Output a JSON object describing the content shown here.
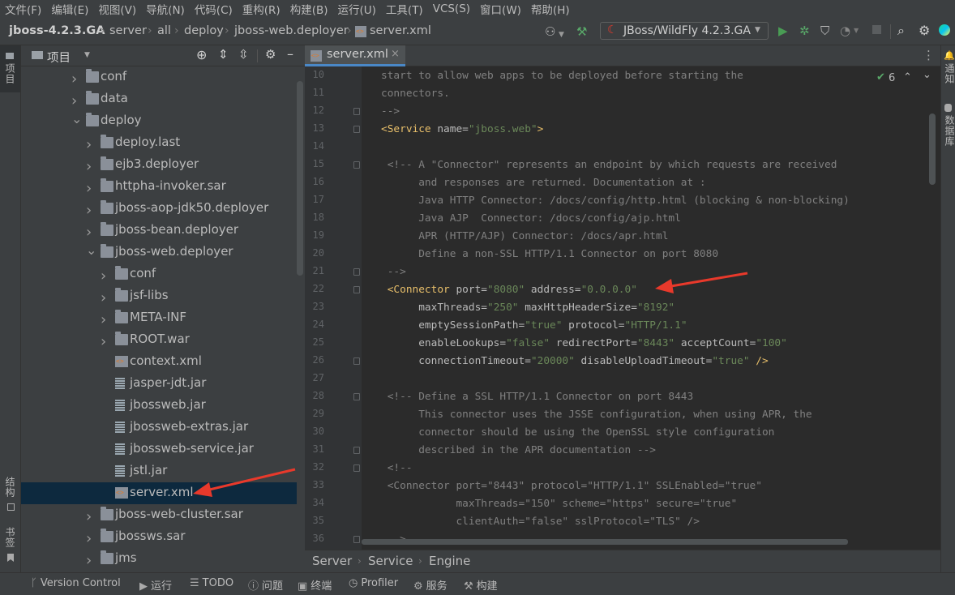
{
  "menu": [
    "文件(F)",
    "编辑(E)",
    "视图(V)",
    "导航(N)",
    "代码(C)",
    "重构(R)",
    "构建(B)",
    "运行(U)",
    "工具(T)",
    "VCS(S)",
    "窗口(W)",
    "帮助(H)"
  ],
  "nav": {
    "crumbs": [
      "jboss-4.2.3.GA",
      "server",
      "all",
      "deploy",
      "jboss-web.deployer",
      "server.xml"
    ],
    "run_config": "JBoss/WildFly 4.2.3.GA"
  },
  "left_stripe": {
    "project": "项目",
    "structure": "结构",
    "bookmarks": "书签"
  },
  "right_stripe": {
    "notifications": "通知",
    "database": "数据库"
  },
  "project_panel": {
    "title": "项目",
    "tree": [
      {
        "label": "conf",
        "type": "folder",
        "depth": 0,
        "expanded": false
      },
      {
        "label": "data",
        "type": "folder",
        "depth": 0,
        "expanded": false
      },
      {
        "label": "deploy",
        "type": "folder",
        "depth": 0,
        "expanded": true
      },
      {
        "label": "deploy.last",
        "type": "folder",
        "depth": 1,
        "expanded": false
      },
      {
        "label": "ejb3.deployer",
        "type": "folder",
        "depth": 1,
        "expanded": false
      },
      {
        "label": "httpha-invoker.sar",
        "type": "folder",
        "depth": 1,
        "expanded": false
      },
      {
        "label": "jboss-aop-jdk50.deployer",
        "type": "folder",
        "depth": 1,
        "expanded": false
      },
      {
        "label": "jboss-bean.deployer",
        "type": "folder",
        "depth": 1,
        "expanded": false
      },
      {
        "label": "jboss-web.deployer",
        "type": "folder",
        "depth": 1,
        "expanded": true
      },
      {
        "label": "conf",
        "type": "folder",
        "depth": 2,
        "expanded": false
      },
      {
        "label": "jsf-libs",
        "type": "folder",
        "depth": 2,
        "expanded": false
      },
      {
        "label": "META-INF",
        "type": "folder",
        "depth": 2,
        "expanded": false
      },
      {
        "label": "ROOT.war",
        "type": "folder",
        "depth": 2,
        "expanded": false
      },
      {
        "label": "context.xml",
        "type": "xml",
        "depth": 2
      },
      {
        "label": "jasper-jdt.jar",
        "type": "jar",
        "depth": 2
      },
      {
        "label": "jbossweb.jar",
        "type": "jar",
        "depth": 2
      },
      {
        "label": "jbossweb-extras.jar",
        "type": "jar",
        "depth": 2
      },
      {
        "label": "jbossweb-service.jar",
        "type": "jar",
        "depth": 2
      },
      {
        "label": "jstl.jar",
        "type": "jar",
        "depth": 2
      },
      {
        "label": "server.xml",
        "type": "xml",
        "depth": 2,
        "selected": true
      },
      {
        "label": "jboss-web-cluster.sar",
        "type": "folder",
        "depth": 1,
        "expanded": false
      },
      {
        "label": "jbossws.sar",
        "type": "folder",
        "depth": 1,
        "expanded": false
      },
      {
        "label": "jms",
        "type": "folder",
        "depth": 1,
        "expanded": false
      }
    ]
  },
  "editor": {
    "tab": "server.xml",
    "inspection_count": "6",
    "lines": [
      {
        "n": "10",
        "fold": false,
        "parts": [
          [
            "cm",
            "start to allow web apps to be deployed before starting the"
          ]
        ],
        "indent": 0
      },
      {
        "n": "11",
        "fold": false,
        "parts": [
          [
            "cm",
            "connectors."
          ]
        ],
        "indent": 0
      },
      {
        "n": "12",
        "fold": true,
        "parts": [
          [
            "cm",
            "-->"
          ]
        ],
        "indent": 0
      },
      {
        "n": "13",
        "fold": true,
        "parts": [
          [
            "tg",
            "<Service "
          ],
          [
            "at",
            "name="
          ],
          [
            "st",
            "\"jboss.web\""
          ],
          [
            "tg",
            ">"
          ]
        ],
        "indent": 0
      },
      {
        "n": "14",
        "fold": false,
        "parts": [],
        "indent": 0
      },
      {
        "n": "15",
        "fold": true,
        "parts": [
          [
            "cm",
            " <!-- A \"Connector\" represents an endpoint by which requests are received"
          ]
        ],
        "indent": 0
      },
      {
        "n": "16",
        "fold": false,
        "parts": [
          [
            "cm",
            "      and responses are returned. Documentation at :"
          ]
        ],
        "indent": 0
      },
      {
        "n": "17",
        "fold": false,
        "parts": [
          [
            "cm",
            "      Java HTTP Connector: /docs/config/http.html (blocking & non-blocking)"
          ]
        ],
        "indent": 0
      },
      {
        "n": "18",
        "fold": false,
        "parts": [
          [
            "cm",
            "      Java AJP  Connector: /docs/config/ajp.html"
          ]
        ],
        "indent": 0
      },
      {
        "n": "19",
        "fold": false,
        "parts": [
          [
            "cm",
            "      APR (HTTP/AJP) Connector: /docs/apr.html"
          ]
        ],
        "indent": 0
      },
      {
        "n": "20",
        "fold": false,
        "parts": [
          [
            "cm",
            "      Define a non-SSL HTTP/1.1 Connector on port 8080"
          ]
        ],
        "indent": 0
      },
      {
        "n": "21",
        "fold": true,
        "parts": [
          [
            "cm",
            " -->"
          ]
        ],
        "indent": 0
      },
      {
        "n": "22",
        "fold": true,
        "parts": [
          [
            "tg",
            " <Connector "
          ],
          [
            "at",
            "port="
          ],
          [
            "st",
            "\"8080\""
          ],
          [
            "at",
            " address="
          ],
          [
            "st",
            "\"0.0.0.0\""
          ]
        ],
        "indent": 0
      },
      {
        "n": "23",
        "fold": false,
        "parts": [
          [
            "at",
            "      maxThreads="
          ],
          [
            "st",
            "\"250\""
          ],
          [
            "at",
            " maxHttpHeaderSize="
          ],
          [
            "st",
            "\"8192\""
          ]
        ],
        "indent": 0
      },
      {
        "n": "24",
        "fold": false,
        "parts": [
          [
            "at",
            "      emptySessionPath="
          ],
          [
            "st",
            "\"true\""
          ],
          [
            "at",
            " protocol="
          ],
          [
            "st",
            "\"HTTP/1.1\""
          ]
        ],
        "indent": 0
      },
      {
        "n": "25",
        "fold": false,
        "parts": [
          [
            "at",
            "      enableLookups="
          ],
          [
            "st",
            "\"false\""
          ],
          [
            "at",
            " redirectPort="
          ],
          [
            "st",
            "\"8443\""
          ],
          [
            "at",
            " acceptCount="
          ],
          [
            "st",
            "\"100\""
          ]
        ],
        "indent": 0
      },
      {
        "n": "26",
        "fold": true,
        "parts": [
          [
            "at",
            "      connectionTimeout="
          ],
          [
            "st",
            "\"20000\""
          ],
          [
            "at",
            " disableUploadTimeout="
          ],
          [
            "st",
            "\"true\""
          ],
          [
            "tg",
            " />"
          ]
        ],
        "indent": 0
      },
      {
        "n": "27",
        "fold": false,
        "parts": [],
        "indent": 0
      },
      {
        "n": "28",
        "fold": true,
        "parts": [
          [
            "cm",
            " <!-- Define a SSL HTTP/1.1 Connector on port 8443"
          ]
        ],
        "indent": 0
      },
      {
        "n": "29",
        "fold": false,
        "parts": [
          [
            "cm",
            "      This connector uses the JSSE configuration, when using APR, the"
          ]
        ],
        "indent": 0
      },
      {
        "n": "30",
        "fold": false,
        "parts": [
          [
            "cm",
            "      connector should be using the OpenSSL style configuration"
          ]
        ],
        "indent": 0
      },
      {
        "n": "31",
        "fold": true,
        "parts": [
          [
            "cm",
            "      described in the APR documentation -->"
          ]
        ],
        "indent": 0
      },
      {
        "n": "32",
        "fold": true,
        "parts": [
          [
            "cm",
            " <!--"
          ]
        ],
        "indent": 0
      },
      {
        "n": "33",
        "fold": false,
        "parts": [
          [
            "cm",
            " <Connector port=\"8443\" protocol=\"HTTP/1.1\" SSLEnabled=\"true\""
          ]
        ],
        "indent": 0
      },
      {
        "n": "34",
        "fold": false,
        "parts": [
          [
            "cm",
            "            maxThreads=\"150\" scheme=\"https\" secure=\"true\""
          ]
        ],
        "indent": 0
      },
      {
        "n": "35",
        "fold": false,
        "parts": [
          [
            "cm",
            "            clientAuth=\"false\" sslProtocol=\"TLS\" />"
          ]
        ],
        "indent": 0
      },
      {
        "n": "36",
        "fold": true,
        "parts": [
          [
            "cm",
            " -->"
          ]
        ],
        "indent": 0
      }
    ]
  },
  "breadcrumb_bottom": [
    "Server",
    "Service",
    "Engine"
  ],
  "tool_windows": [
    "Version Control",
    "运行",
    "TODO",
    "问题",
    "终端",
    "Profiler",
    "服务",
    "构建"
  ],
  "colors": {
    "accent": "#4a88c7",
    "selection": "#0d293e",
    "run_green": "#499c54",
    "annotation_red": "#e8392b"
  }
}
